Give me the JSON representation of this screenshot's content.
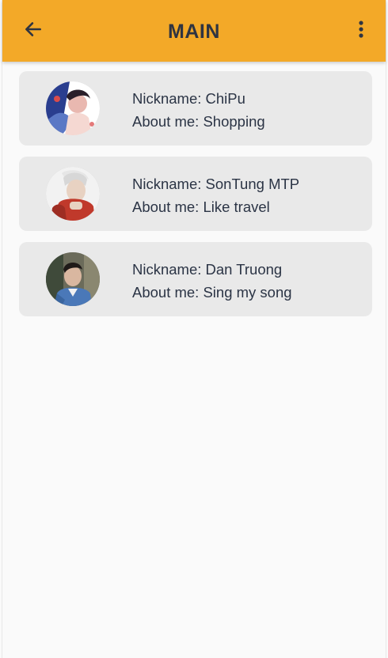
{
  "header": {
    "title": "MAIN",
    "back_icon": "arrow-left-icon",
    "menu_icon": "more-vertical-icon",
    "color": "#f3a928"
  },
  "profiles": [
    {
      "nickname_label": "Nickname: ChiPu",
      "about_label": "About me: Shopping",
      "avatar_colors": [
        "#2a3e8f",
        "#e9b8b0",
        "#ffffff"
      ]
    },
    {
      "nickname_label": "Nickname: SonTung MTP",
      "about_label": "About me: Like travel",
      "avatar_colors": [
        "#c0392b",
        "#e8d2c2",
        "#f2f2f2"
      ]
    },
    {
      "nickname_label": "Nickname: Dan Truong",
      "about_label": "About me: Sing my song",
      "avatar_colors": [
        "#4a78b8",
        "#d9b7a0",
        "#2f3a2f"
      ]
    }
  ]
}
